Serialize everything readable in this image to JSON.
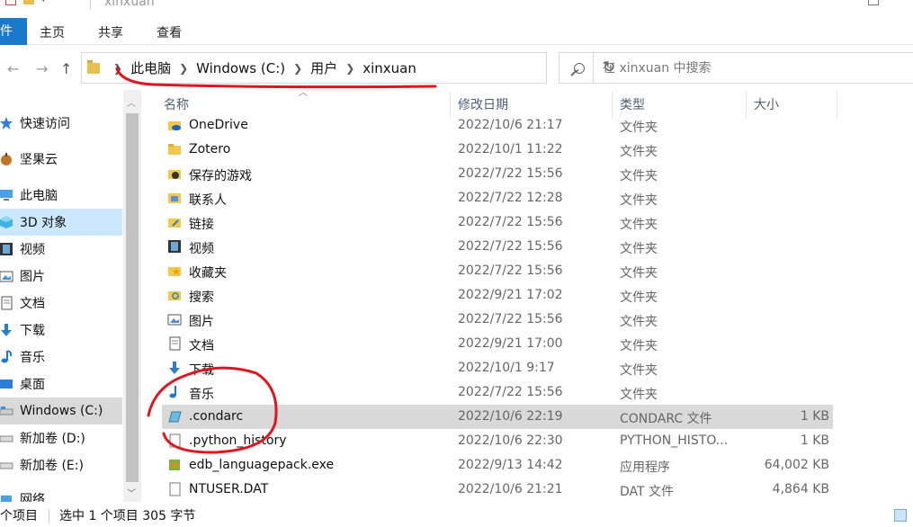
{
  "window": {
    "title": "xinxuan"
  },
  "ribbon": {
    "file_tab": "件",
    "tabs": [
      "主页",
      "共享",
      "查看"
    ]
  },
  "address": {
    "crumbs": [
      "此电脑",
      "Windows (C:)",
      "用户",
      "xinxuan"
    ],
    "search_placeholder": "在 xinxuan 中搜索"
  },
  "sidebar": {
    "items": [
      {
        "label": "快速访问",
        "icon": "star-icon"
      },
      {
        "label": "坚果云",
        "icon": "nut-cloud-icon"
      },
      {
        "label": "此电脑",
        "icon": "computer-icon"
      },
      {
        "label": "3D 对象",
        "icon": "cube-3d-icon"
      },
      {
        "label": "视频",
        "icon": "video-icon"
      },
      {
        "label": "图片",
        "icon": "picture-icon"
      },
      {
        "label": "文档",
        "icon": "document-icon"
      },
      {
        "label": "下载",
        "icon": "download-icon"
      },
      {
        "label": "音乐",
        "icon": "music-icon"
      },
      {
        "label": "桌面",
        "icon": "desktop-icon"
      },
      {
        "label": "Windows (C:)",
        "icon": "drive-icon"
      },
      {
        "label": "新加卷 (D:)",
        "icon": "drive-icon"
      },
      {
        "label": "新加卷 (E:)",
        "icon": "drive-icon"
      },
      {
        "label": "网络",
        "icon": "network-icon"
      }
    ]
  },
  "columns": {
    "name": "名称",
    "date": "修改日期",
    "type": "类型",
    "size": "大小"
  },
  "files": [
    {
      "name": "OneDrive",
      "date": "2022/10/6 21:17",
      "type": "文件夹",
      "size": "",
      "icon": "onedrive-icon"
    },
    {
      "name": "Zotero",
      "date": "2022/10/1 11:22",
      "type": "文件夹",
      "size": "",
      "icon": "folder-icon"
    },
    {
      "name": "保存的游戏",
      "date": "2022/7/22 15:56",
      "type": "文件夹",
      "size": "",
      "icon": "saved-games-icon"
    },
    {
      "name": "联系人",
      "date": "2022/7/22 12:28",
      "type": "文件夹",
      "size": "",
      "icon": "contacts-icon"
    },
    {
      "name": "链接",
      "date": "2022/7/22 15:56",
      "type": "文件夹",
      "size": "",
      "icon": "links-icon"
    },
    {
      "name": "视频",
      "date": "2022/7/22 15:56",
      "type": "文件夹",
      "size": "",
      "icon": "video-icon"
    },
    {
      "name": "收藏夹",
      "date": "2022/7/22 15:56",
      "type": "文件夹",
      "size": "",
      "icon": "favorites-icon"
    },
    {
      "name": "搜索",
      "date": "2022/9/21 17:02",
      "type": "文件夹",
      "size": "",
      "icon": "search-folder-icon"
    },
    {
      "name": "图片",
      "date": "2022/7/22 15:56",
      "type": "文件夹",
      "size": "",
      "icon": "picture-icon"
    },
    {
      "name": "文档",
      "date": "2022/9/21 17:00",
      "type": "文件夹",
      "size": "",
      "icon": "document-icon"
    },
    {
      "name": "下载",
      "date": "2022/10/1 9:17",
      "type": "文件夹",
      "size": "",
      "icon": "download-icon"
    },
    {
      "name": "音乐",
      "date": "2022/7/22 15:56",
      "type": "文件夹",
      "size": "",
      "icon": "music-icon"
    },
    {
      "name": ".condarc",
      "date": "2022/10/6 22:19",
      "type": "CONDARC 文件",
      "size": "1 KB",
      "icon": "condarc-file-icon"
    },
    {
      "name": ".python_history",
      "date": "2022/10/6 22:30",
      "type": "PYTHON_HISTO...",
      "size": "1 KB",
      "icon": "blank-file-icon"
    },
    {
      "name": "edb_languagepack.exe",
      "date": "2022/9/13 14:42",
      "type": "应用程序",
      "size": "64,002 KB",
      "icon": "installer-icon"
    },
    {
      "name": "NTUSER.DAT",
      "date": "2022/10/6 21:21",
      "type": "DAT 文件",
      "size": "4,864 KB",
      "icon": "blank-file-icon"
    }
  ],
  "status": {
    "count": "个项目",
    "selection": "选中 1 个项目  305 字节"
  },
  "colors": {
    "accent": "#1979ca",
    "selection": "#d9d9d9",
    "annotation": "#e0161e"
  }
}
